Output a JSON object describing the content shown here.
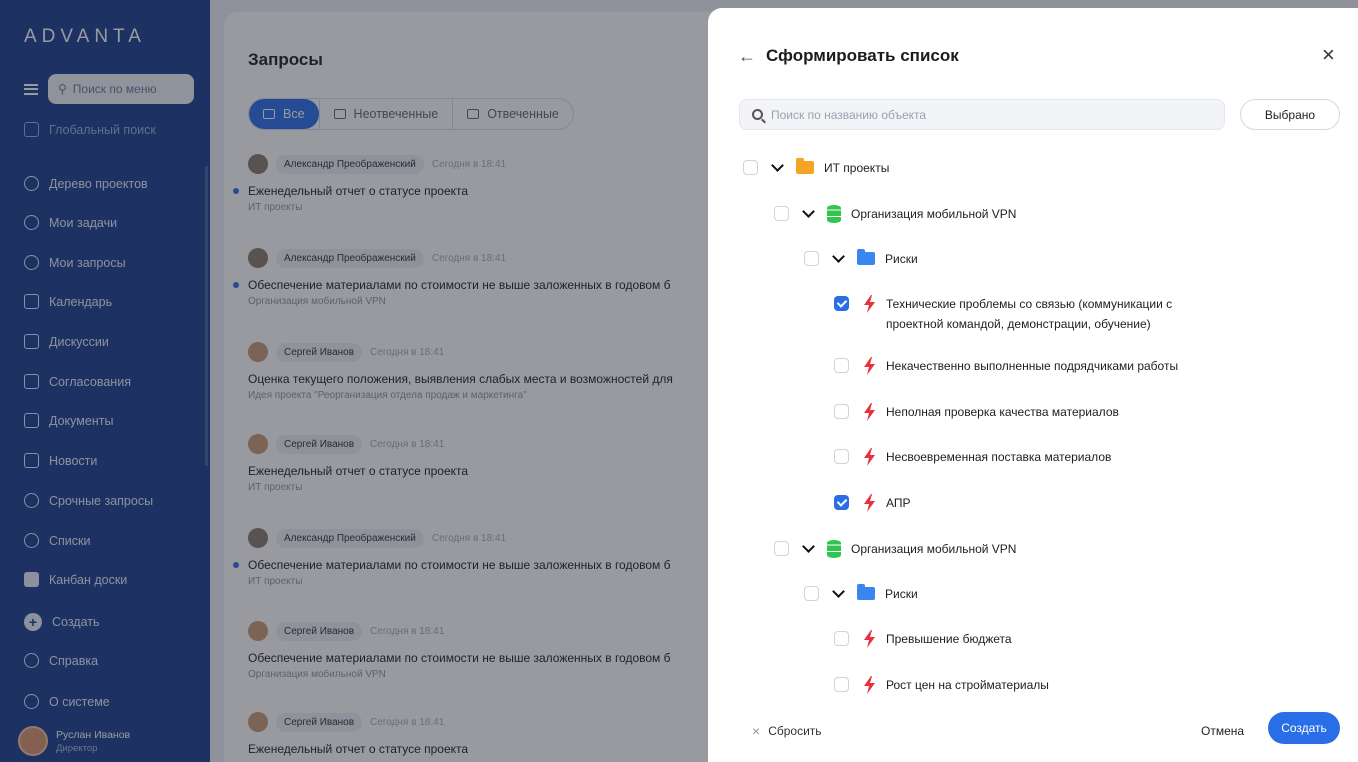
{
  "sidebar": {
    "logo": "ADVANTA",
    "menu_search_placeholder": "Поиск по меню",
    "global_search": "Глобальный поиск",
    "items": [
      {
        "label": "Дерево проектов",
        "icon": "project-tree-icon"
      },
      {
        "label": "Мои задачи",
        "icon": "check-circle-icon"
      },
      {
        "label": "Мои запросы",
        "icon": "arrow-circle-icon"
      },
      {
        "label": "Календарь",
        "icon": "calendar-icon"
      },
      {
        "label": "Дискуссии",
        "icon": "chat-icon"
      },
      {
        "label": "Согласования",
        "icon": "book-icon"
      },
      {
        "label": "Документы",
        "icon": "document-icon"
      },
      {
        "label": "Новости",
        "icon": "news-icon"
      },
      {
        "label": "Срочные запросы",
        "icon": "clock-icon"
      },
      {
        "label": "Списки",
        "icon": "bell-icon"
      },
      {
        "label": "Канбан доски",
        "icon": "kanban-icon"
      }
    ],
    "create": "Создать",
    "help": "Справка",
    "about": "О системе",
    "user": {
      "name": "Руслан Иванов",
      "role": "Директор"
    }
  },
  "main": {
    "title": "Запросы",
    "tabs": [
      {
        "label": "Все",
        "active": true
      },
      {
        "label": "Неотвеченные",
        "active": false
      },
      {
        "label": "Отвеченные",
        "active": false
      }
    ],
    "requests": [
      {
        "author": "Александр Преображенский",
        "time": "Сегодня в 18:41",
        "title": "Еженедельный отчет о статусе проекта",
        "sub": "ИТ проекты",
        "unread": true
      },
      {
        "author": "Александр Преображенский",
        "time": "Сегодня в 18:41",
        "title": "Обеспечение материалами по стоимости не выше заложенных в годовом б",
        "sub": "Организация мобильной VPN",
        "unread": true
      },
      {
        "author": "Сергей Иванов",
        "time": "Сегодня в 18:41",
        "title": "Оценка текущего положения, выявления слабых места и возможностей для",
        "sub": "Идея проекта \"Реорганизация отдела продаж и маркетинга\"",
        "unread": false
      },
      {
        "author": "Сергей Иванов",
        "time": "Сегодня в 18:41",
        "title": "Еженедельный отчет о статусе проекта",
        "sub": "ИТ проекты",
        "unread": false
      },
      {
        "author": "Александр Преображенский",
        "time": "Сегодня в 18:41",
        "title": "Обеспечение материалами по стоимости не выше заложенных в годовом б",
        "sub": "ИТ проекты",
        "unread": true
      },
      {
        "author": "Сергей Иванов",
        "time": "Сегодня в 18:41",
        "title": "Обеспечение материалами по стоимости не выше заложенных в годовом б",
        "sub": "Организация мобильной VPN",
        "unread": false
      },
      {
        "author": "Сергей Иванов",
        "time": "Сегодня в 18:41",
        "title": "Еженедельный отчет о статусе проекта",
        "sub": "",
        "unread": false
      }
    ]
  },
  "drawer": {
    "title": "Сформировать список",
    "search_placeholder": "Поиск по названию объекта",
    "selected_button": "Выбрано",
    "tree": [
      {
        "label": "ИТ проекты",
        "type": "folder-orange",
        "checked": false
      },
      {
        "label": "Организация мобильной VPN",
        "type": "database",
        "checked": false
      },
      {
        "label": "Риски",
        "type": "folder-blue",
        "checked": false
      },
      {
        "label": "Технические проблемы со связью (коммуникации с",
        "label2": "проектной командой, демонстрации, обучение)",
        "type": "risk",
        "checked": true
      },
      {
        "label": "Некачественно выполненные подрядчиками работы",
        "type": "risk",
        "checked": false
      },
      {
        "label": "Неполная проверка качества материалов",
        "type": "risk",
        "checked": false
      },
      {
        "label": "Несвоевременная поставка материалов",
        "type": "risk",
        "checked": false
      },
      {
        "label": "АПР",
        "type": "risk",
        "checked": true
      },
      {
        "label": "Организация мобильной VPN",
        "type": "database",
        "checked": false
      },
      {
        "label": "Риски",
        "type": "folder-blue",
        "checked": false
      },
      {
        "label": "Превышение бюджета",
        "type": "risk",
        "checked": false
      },
      {
        "label": "Рост цен на стройматериалы",
        "type": "risk",
        "checked": false
      }
    ],
    "reset": "Сбросить",
    "cancel": "Отмена",
    "create": "Создать"
  },
  "colors": {
    "brand": "#1c3f8c",
    "accent": "#2a6ee7",
    "risk": "#e5313b",
    "folder_orange": "#f7a325",
    "folder_blue": "#3a86f0",
    "database": "#2fc54f"
  }
}
